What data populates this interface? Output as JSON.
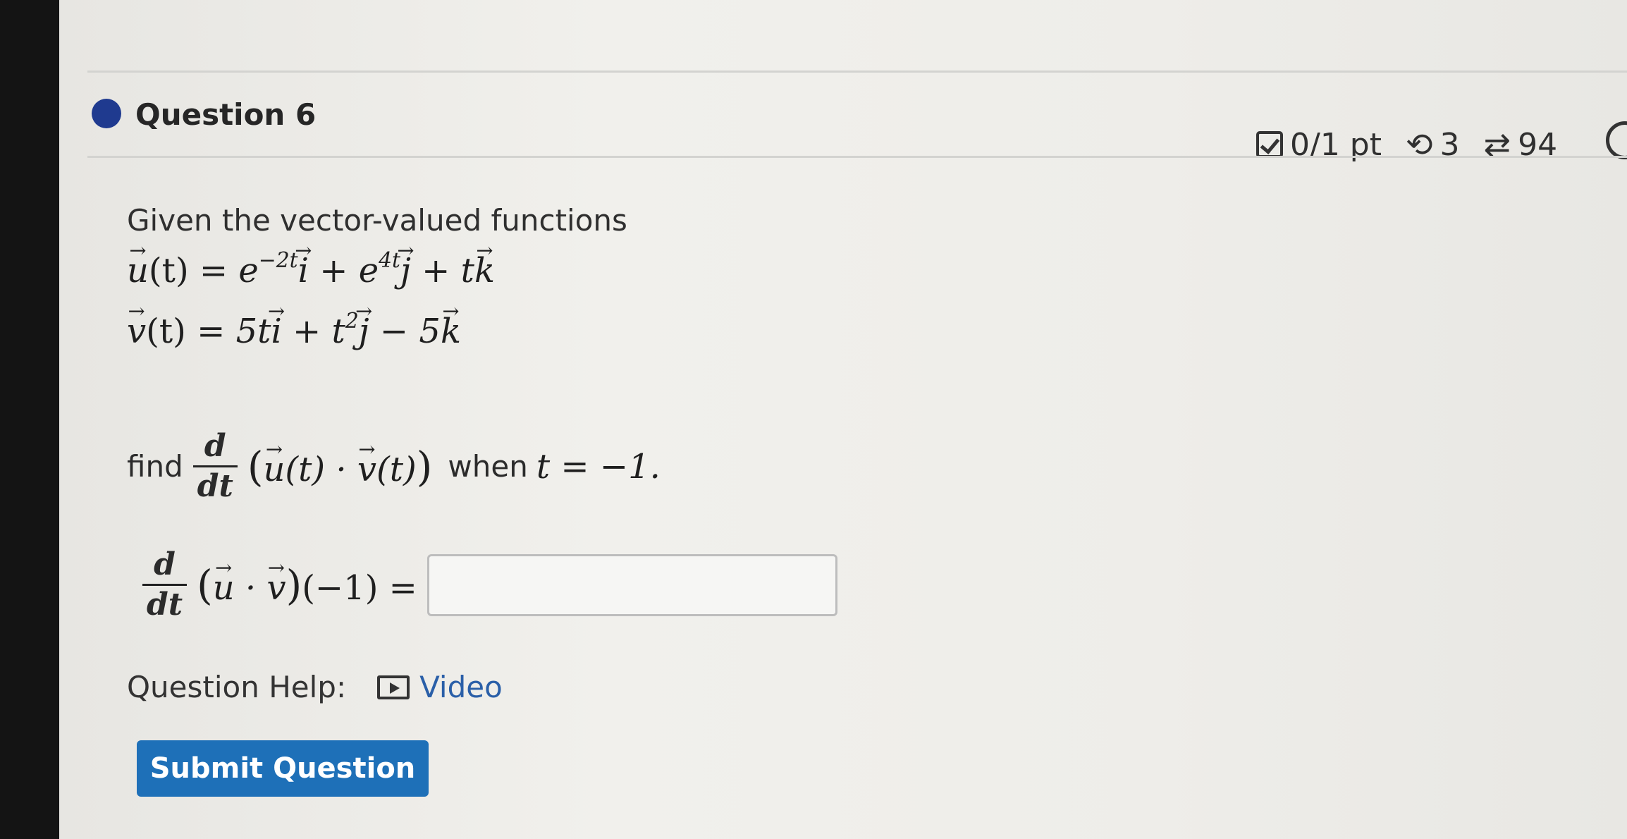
{
  "question": {
    "title": "Question 6",
    "score": "0/1 pt",
    "retries": "3",
    "attempts": "94"
  },
  "prompt": "Given the vector-valued functions",
  "equations": {
    "u": {
      "lhs_var": "u",
      "lhs_arg": "(t) = ",
      "t1_base": "e",
      "t1_exp": "−2t",
      "t1_unit": "i",
      "t2_op": " + ",
      "t2_base": "e",
      "t2_exp": "4t",
      "t2_unit": "j",
      "t3_op": " + ",
      "t3_coef": "t",
      "t3_unit": "k"
    },
    "v": {
      "lhs_var": "v",
      "lhs_arg": "(t) = ",
      "t1_coef": "5t",
      "t1_unit": "i",
      "t2_op": " + ",
      "t2_base": "t",
      "t2_exp": "2",
      "t2_unit": "j",
      "t3_op": " − ",
      "t3_coef": "5",
      "t3_unit": "k"
    }
  },
  "find": {
    "label": "find",
    "d": "d",
    "dt": "dt",
    "open": "(",
    "u": "u",
    "mid1": "(t) · ",
    "v": "v",
    "mid2": "(t)",
    "close": ")",
    "when_label": "when",
    "condition": "t = −1."
  },
  "answer": {
    "d": "d",
    "dt": "dt",
    "open": "(",
    "u": "u",
    "dot": " · ",
    "v": "v",
    "close": ")",
    "tail": "(−1) =",
    "value": ""
  },
  "help": {
    "label": "Question Help:",
    "video_label": "Video"
  },
  "submit_label": "Submit Question",
  "colors": {
    "accent_blue": "#1e70b8",
    "question_dot": "#1f3a8f",
    "link": "#2a5fa8"
  }
}
